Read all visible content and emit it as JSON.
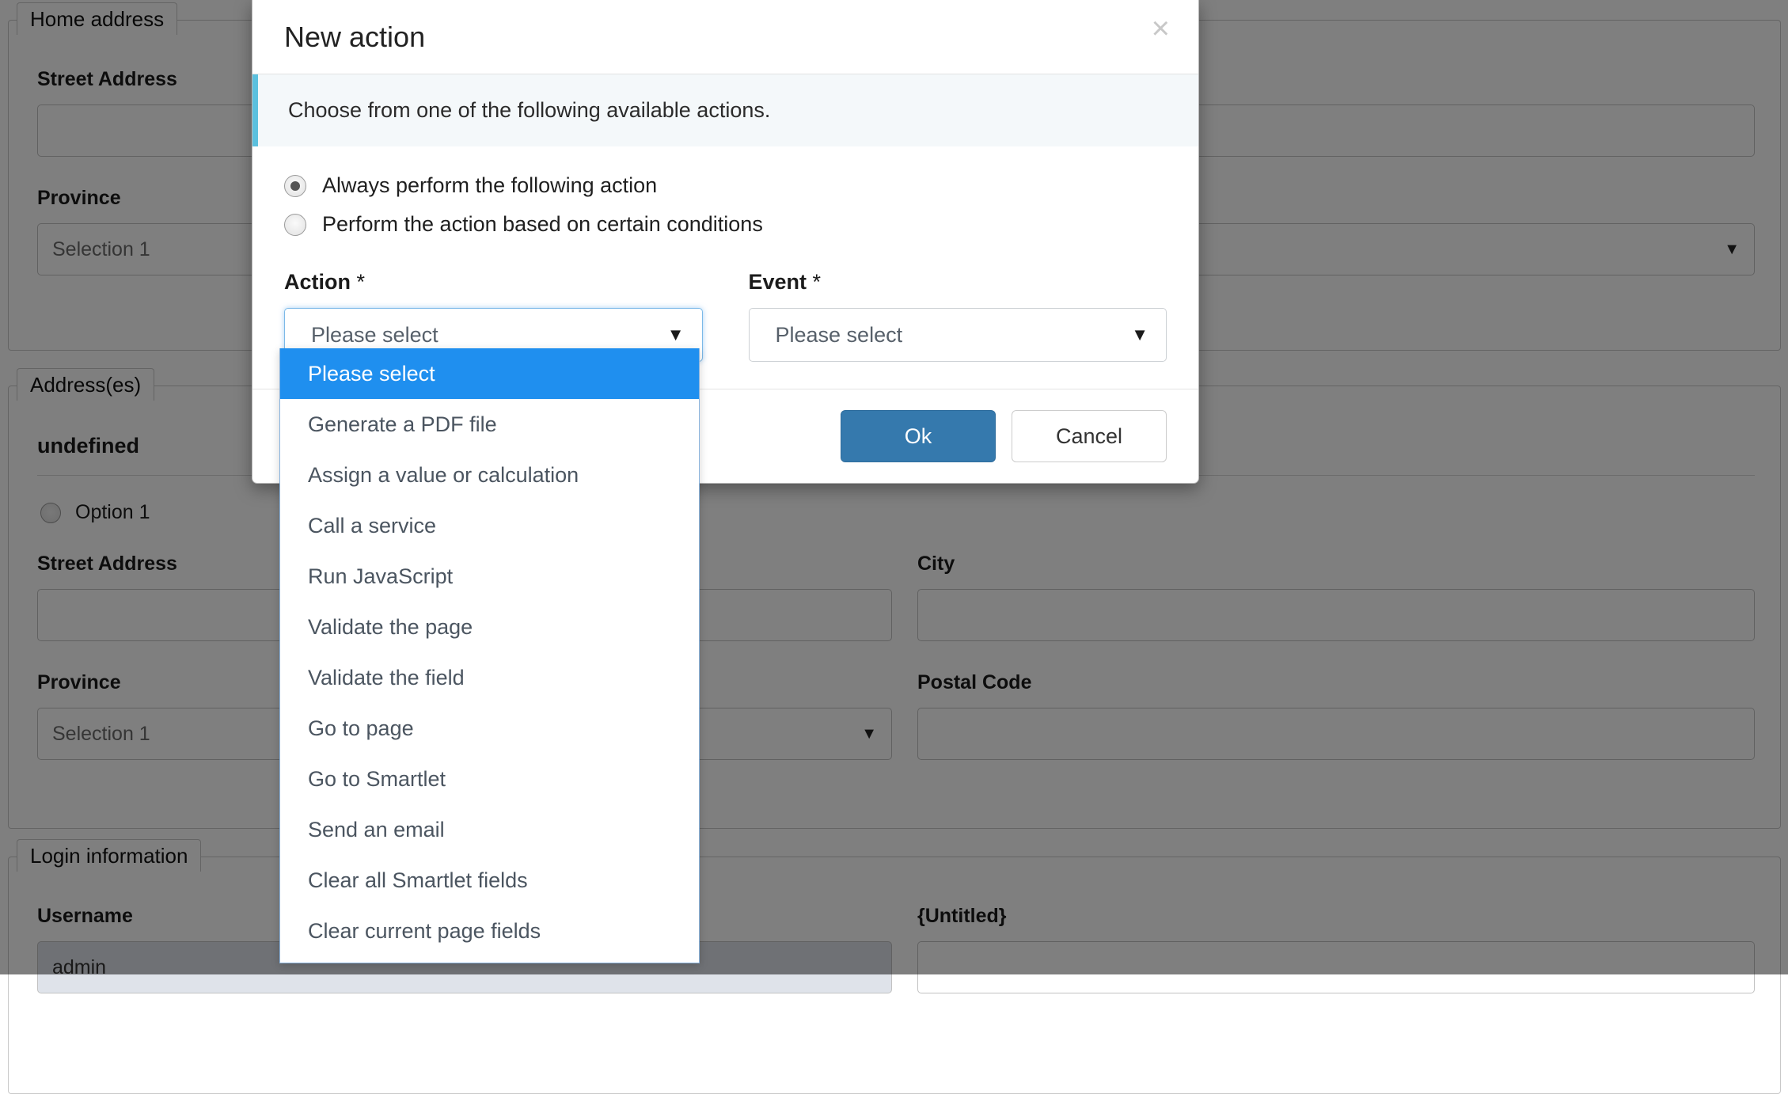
{
  "background_form": {
    "sections": [
      {
        "legend": "Home address",
        "fields": [
          {
            "label": "Street Address",
            "type": "text",
            "value": ""
          },
          {
            "label": "Province",
            "type": "select",
            "value": "Selection 1"
          }
        ]
      },
      {
        "legend": "Address(es)",
        "heading": "undefined",
        "radio_label": "Option 1",
        "fields": [
          {
            "label": "Street Address",
            "type": "text",
            "value": ""
          },
          {
            "label": "City",
            "type": "text",
            "value": ""
          },
          {
            "label": "Province",
            "type": "select",
            "value": "Selection 1"
          },
          {
            "label": "Postal Code",
            "type": "text",
            "value": ""
          }
        ],
        "extra_select_value": ""
      },
      {
        "legend": "Login information",
        "fields": [
          {
            "label": "Username",
            "type": "text",
            "value": "admin"
          },
          {
            "label": "{Untitled}",
            "type": "text",
            "value": ""
          }
        ]
      }
    ]
  },
  "modal": {
    "title": "New action",
    "close_label": "×",
    "info_text": "Choose from one of the following available actions.",
    "radio_options": [
      {
        "label": "Always perform the following action",
        "checked": true
      },
      {
        "label": "Perform the action based on certain conditions",
        "checked": false
      }
    ],
    "action_field": {
      "label": "Action",
      "required_mark": "*",
      "value": "Please select"
    },
    "event_field": {
      "label": "Event",
      "required_mark": "*",
      "value": "Please select"
    },
    "dropdown": {
      "selected_index": 0,
      "options": [
        "Please select",
        "Generate a PDF file",
        "Assign a value or calculation",
        "Call a service",
        "Run JavaScript",
        "Validate the page",
        "Validate the field",
        "Go to page",
        "Go to Smartlet",
        "Send an email",
        "Clear all Smartlet fields",
        "Clear current page fields"
      ]
    },
    "buttons": {
      "ok": "Ok",
      "cancel": "Cancel"
    },
    "colors": {
      "info_accent": "#5bc0de",
      "highlight": "#1f8fef",
      "primary_button": "#3579ad",
      "focus_ring": "#7cb9e8"
    }
  }
}
